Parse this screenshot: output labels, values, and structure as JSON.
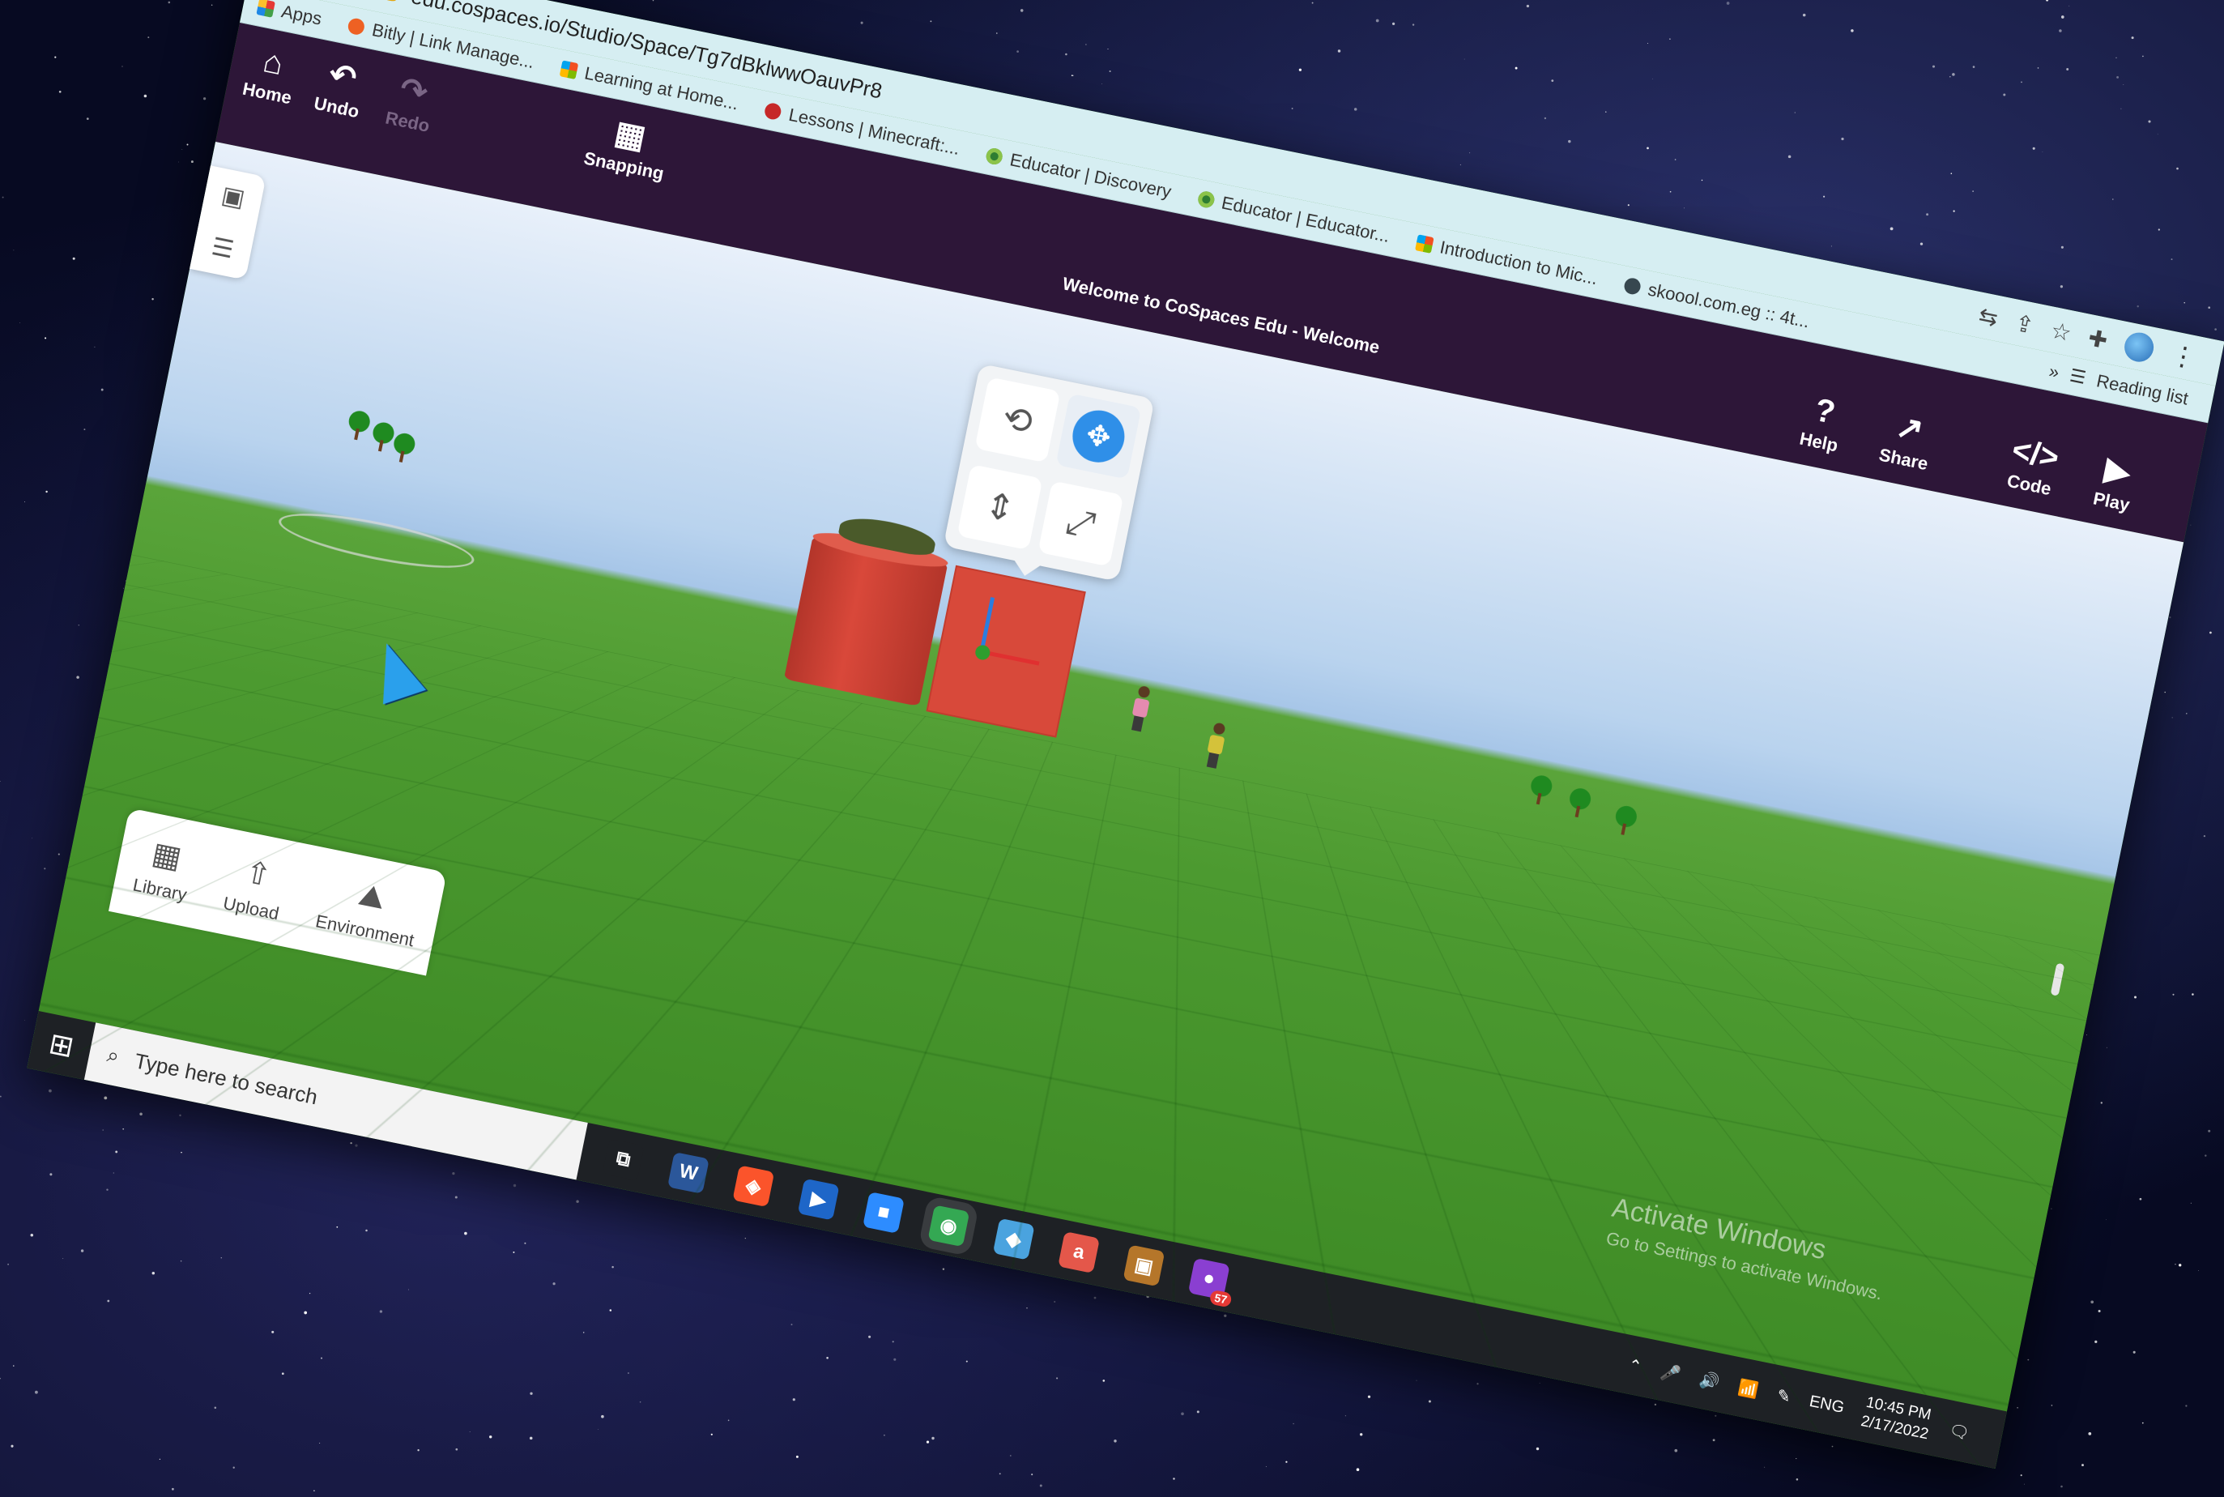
{
  "browser": {
    "url": "edu.cospaces.io/Studio/Space/Tg7dBklwwOauvPr8",
    "back_icon": "←",
    "forward_icon": "→",
    "reload_icon": "⟳",
    "bookmarks": [
      {
        "label": "Apps",
        "icon": "apps"
      },
      {
        "label": "Bitly | Link Manage...",
        "icon": "bitly"
      },
      {
        "label": "Learning at Home...",
        "icon": "ms"
      },
      {
        "label": "Lessons | Minecraft:...",
        "icon": "mc"
      },
      {
        "label": "Educator | Discovery",
        "icon": "edu"
      },
      {
        "label": "Educator | Educator...",
        "icon": "edu"
      },
      {
        "label": "Introduction to Mic...",
        "icon": "ms"
      },
      {
        "label": "skoool.com.eg :: 4t...",
        "icon": "globe"
      }
    ],
    "more_bookmarks": "»",
    "reading_list": "Reading list"
  },
  "cospaces": {
    "home": "Home",
    "undo": "Undo",
    "redo": "Redo",
    "snapping": "Snapping",
    "title": "Welcome to CoSpaces Edu - Welcome",
    "help": "Help",
    "share": "Share",
    "code": "Code",
    "play": "Play",
    "library": "Library",
    "upload": "Upload",
    "environment": "Environment"
  },
  "watermark": {
    "title": "Activate Windows",
    "subtitle": "Go to Settings to activate Windows."
  },
  "taskbar": {
    "search_placeholder": "Type here to search",
    "apps": [
      {
        "name": "task-view",
        "glyph": "⧉",
        "color": "#1e2125"
      },
      {
        "name": "word",
        "glyph": "W",
        "color": "#2b579a"
      },
      {
        "name": "brave",
        "glyph": "◈",
        "color": "#fb542b"
      },
      {
        "name": "media-player",
        "glyph": "▶",
        "color": "#1e66c8"
      },
      {
        "name": "zoom",
        "glyph": "■",
        "color": "#2d8cff"
      },
      {
        "name": "chrome",
        "glyph": "◉",
        "color": "#34a853"
      },
      {
        "name": "app-blue",
        "glyph": "◆",
        "color": "#4aa3df"
      },
      {
        "name": "app-red",
        "glyph": "a",
        "color": "#e4574a"
      },
      {
        "name": "app-box",
        "glyph": "▣",
        "color": "#b5762a"
      },
      {
        "name": "app-badge",
        "glyph": "●",
        "color": "#8a3fd1",
        "badge": "57"
      }
    ],
    "language": "ENG",
    "time": "10:45 PM",
    "date": "2/17/2022"
  }
}
